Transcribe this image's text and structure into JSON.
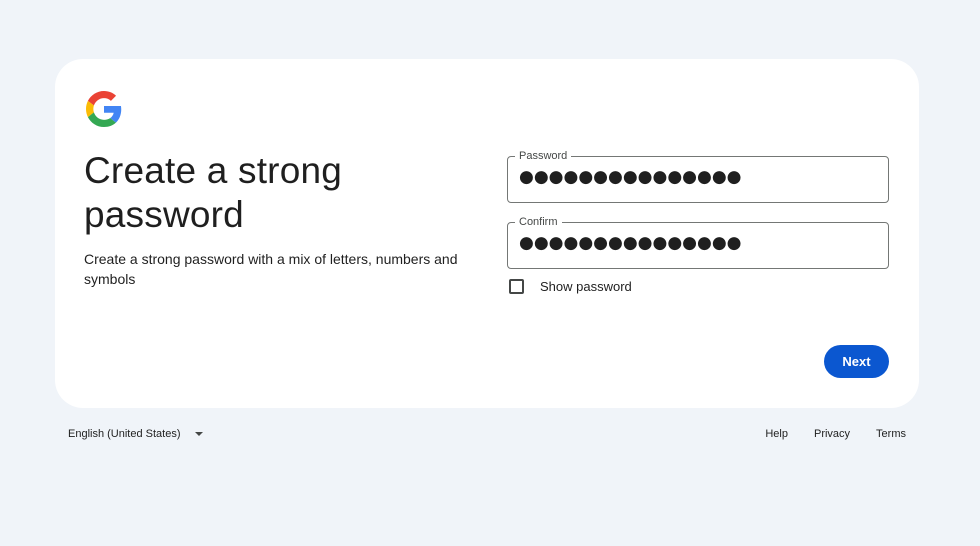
{
  "page": {
    "title": "Create a strong password",
    "subtitle": "Create a strong password with a mix of letters, numbers and symbols"
  },
  "brand": {
    "logo_icon": "google-g-icon",
    "colors": {
      "blue": "#4285F4",
      "red": "#EA4335",
      "yellow": "#FBBC05",
      "green": "#34A853"
    }
  },
  "form": {
    "password": {
      "label": "Password",
      "value": "●●●●●●●●●●●●●●●"
    },
    "confirm": {
      "label": "Confirm",
      "value": "●●●●●●●●●●●●●●●"
    },
    "show_password": {
      "label": "Show password",
      "checked": false
    }
  },
  "actions": {
    "next_label": "Next",
    "accent": "#0b57d0"
  },
  "footer": {
    "language": "English (United States)",
    "links": [
      "Help",
      "Privacy",
      "Terms"
    ]
  }
}
